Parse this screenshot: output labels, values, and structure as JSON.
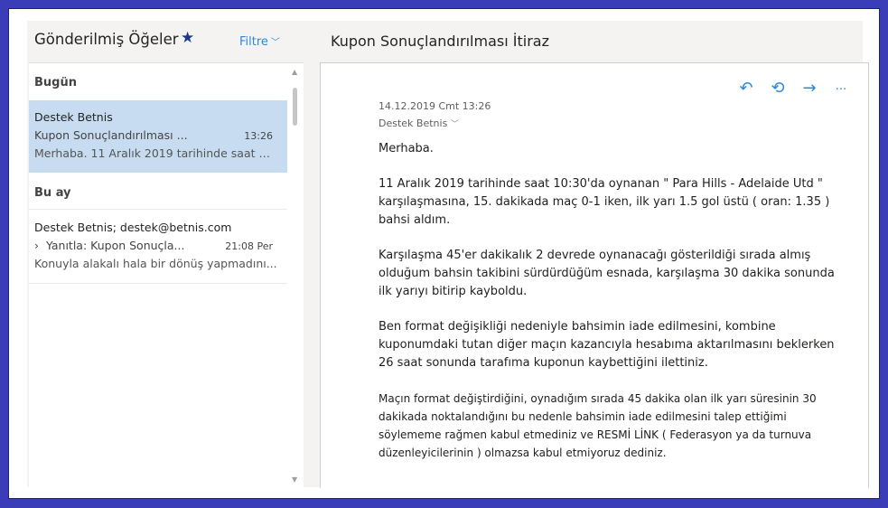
{
  "folder": {
    "title": "Gönderilmiş Öğeler",
    "star_icon": "★",
    "filter_label": "Filtre",
    "filter_chevron": "﹀"
  },
  "groups": {
    "today": "Bugün",
    "this_month": "Bu ay"
  },
  "messages": [
    {
      "from": "Destek Betnis",
      "subject": "Kupon Sonuçlandırılması ...",
      "time": "13:26",
      "preview": "Merhaba. 11 Aralık 2019 tarihinde saat 1..."
    },
    {
      "from": "Destek Betnis; destek@betnis.com",
      "subject": "Yanıtla: Kupon Sonuçla...",
      "reply_icon": "›",
      "time": "21:08 Per",
      "preview": "Konuyla alakalı hala bir dönüş yapmadını..."
    }
  ],
  "reading": {
    "subject": "Kupon Sonuçlandırılması İtiraz",
    "date": "14.12.2019 Cmt 13:26",
    "from": "Destek Betnis",
    "from_chevron": "﹀",
    "actions": {
      "reply": "↶",
      "reply_all": "⟲",
      "forward": "→",
      "more": "···"
    },
    "paragraphs": [
      "Merhaba.",
      "11 Aralık 2019 tarihinde saat 10:30'da oynanan \" Para Hills - Adelaide Utd \" karşılaşmasına, 15. dakikada maç 0-1 iken, ilk yarı 1.5 gol üstü ( oran: 1.35 ) bahsi aldım.",
      "Karşılaşma 45'er dakikalık 2 devrede oynanacağı gösterildiği sırada almış olduğum bahsin takibini sürdürdüğüm esnada, karşılaşma 30 dakika sonunda ilk yarıyı bitirip kayboldu.",
      "Ben format değişikliği nedeniyle bahsimin iade edilmesini, kombine kuponumdaki tutan diğer maçın kazancıyla hesabıma aktarılmasını beklerken 26 saat sonunda tarafıma kuponun kaybettiğini ilettiniz.",
      "Maçın format değiştirdiğini, oynadığım sırada 45 dakika olan ilk yarı süresinin 30 dakikada noktalandığını bu nedenle bahsimin iade edilmesini talep ettiğimi söylememe rağmen kabul etmediniz ve RESMİ LİNK ( Federasyon ya da turnuva düzenleyicilerinin ) olmazsa kabul etmiyoruz dediniz."
    ]
  },
  "colors": {
    "accent": "#2b88d8",
    "selected": "#c7dcf1",
    "frame": "#3b3db8"
  }
}
